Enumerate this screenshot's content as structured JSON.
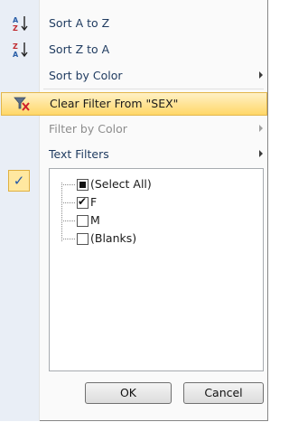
{
  "menu": {
    "sort_az": {
      "label": "Sort A to Z",
      "icon": "sort-ascending-icon"
    },
    "sort_za": {
      "label": "Sort Z to A",
      "icon": "sort-descending-icon"
    },
    "sort_color": {
      "label": "Sort by Color"
    },
    "clear_filter": {
      "label": "Clear Filter From \"SEX\"",
      "icon": "clear-filter-icon"
    },
    "filter_color": {
      "label": "Filter by Color"
    },
    "text_filters": {
      "label": "Text Filters"
    }
  },
  "filter_list": {
    "items": [
      {
        "label": "(Select All)",
        "state": "partial"
      },
      {
        "label": "F",
        "state": "checked"
      },
      {
        "label": "M",
        "state": "unchecked"
      },
      {
        "label": "(Blanks)",
        "state": "unchecked"
      }
    ]
  },
  "buttons": {
    "ok": "OK",
    "cancel": "Cancel"
  },
  "colors": {
    "highlight_top": "#fff1c6",
    "highlight_bottom": "#ffd768",
    "gutter": "#e9eef6",
    "text": "#1e3a5f"
  }
}
